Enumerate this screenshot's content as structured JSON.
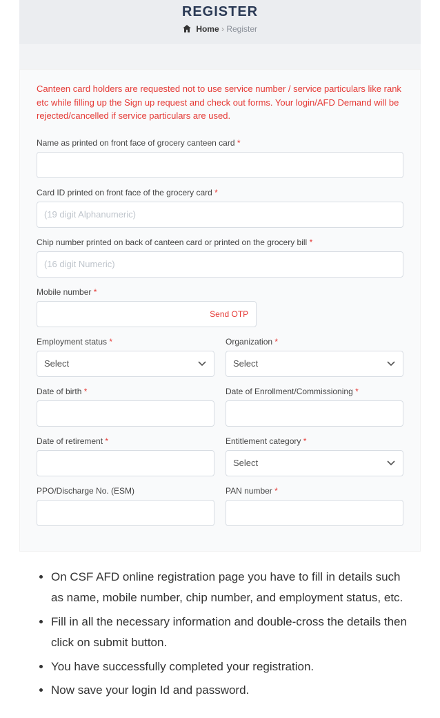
{
  "header": {
    "title": "REGISTER",
    "breadcrumb_home": "Home",
    "breadcrumb_current": "Register"
  },
  "warning_text": "Canteen card holders are requested not to use service number / service particulars like rank etc while filling up the Sign up request and check out forms. Your login/AFD Demand will be rejected/cancelled if service particulars are used.",
  "fields": {
    "name_label": "Name as printed on front face of grocery canteen card",
    "card_id_label": "Card ID printed on front face of the grocery card",
    "card_id_placeholder": "(19 digit Alphanumeric)",
    "chip_label": "Chip number printed on back of canteen card or printed on the grocery bill",
    "chip_placeholder": "(16 digit Numeric)",
    "mobile_label": "Mobile number",
    "send_otp_label": "Send OTP",
    "employment_label": "Employment status",
    "organization_label": "Organization",
    "dob_label": "Date of birth",
    "enrollment_label": "Date of Enrollment/Commissioning",
    "retirement_label": "Date of retirement",
    "entitlement_label": "Entitlement category",
    "ppo_label": "PPO/Discharge No. (ESM)",
    "pan_label": "PAN number",
    "select_option": "Select"
  },
  "bullets": [
    "On CSF AFD online registration page you have to fill in details such as name, mobile number, chip number, and employment status, etc.",
    "Fill in all the necessary information and double-cross the details then click on submit button.",
    "You have successfully completed your registration.",
    "Now save your login Id and password."
  ]
}
